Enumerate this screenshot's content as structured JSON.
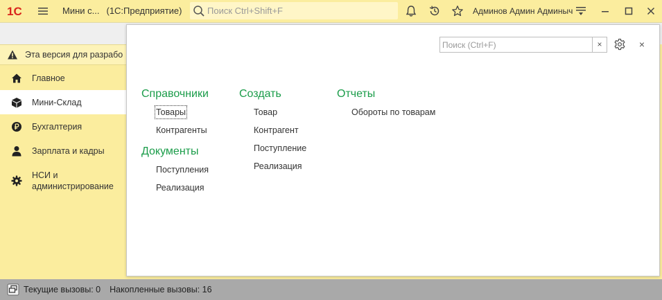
{
  "titlebar": {
    "logo_text": "1С",
    "title": "Мини с...",
    "subtitle": "(1С:Предприятие)",
    "search_placeholder": "Поиск Ctrl+Shift+F",
    "user": "Админов Админ Админыч"
  },
  "banner": {
    "text": "Эта версия для разрабо"
  },
  "sidebar": {
    "items": [
      {
        "label": "Главное",
        "icon": "home-icon"
      },
      {
        "label": "Мини-Склад",
        "icon": "box-icon"
      },
      {
        "label": "Бухгалтерия",
        "icon": "ruble-icon"
      },
      {
        "label": "Зарплата и кадры",
        "icon": "person-icon"
      },
      {
        "label": "НСИ и администрирование",
        "icon": "gear-icon"
      }
    ],
    "active": "Мини-Склад"
  },
  "panel": {
    "search_placeholder": "Поиск (Ctrl+F)",
    "clear_label": "×",
    "close_label": "×",
    "columns": [
      {
        "groups": [
          {
            "title": "Справочники",
            "links": [
              "Товары",
              "Контрагенты"
            ]
          },
          {
            "title": "Документы",
            "links": [
              "Поступления",
              "Реализация"
            ]
          }
        ]
      },
      {
        "groups": [
          {
            "title": "Создать",
            "links": [
              "Товар",
              "Контрагент",
              "Поступление",
              "Реализация"
            ]
          }
        ]
      },
      {
        "groups": [
          {
            "title": "Отчеты",
            "links": [
              "Обороты по товарам"
            ]
          }
        ]
      }
    ]
  },
  "statusbar": {
    "current_calls": "Текущие вызовы: 0",
    "accumulated_calls": "Накопленные вызовы: 16"
  },
  "colors": {
    "accent_yellow": "#fbed9e",
    "group_green": "#1a9c49",
    "logo_red": "#d9261c",
    "status_gray": "#a9a9a9"
  }
}
